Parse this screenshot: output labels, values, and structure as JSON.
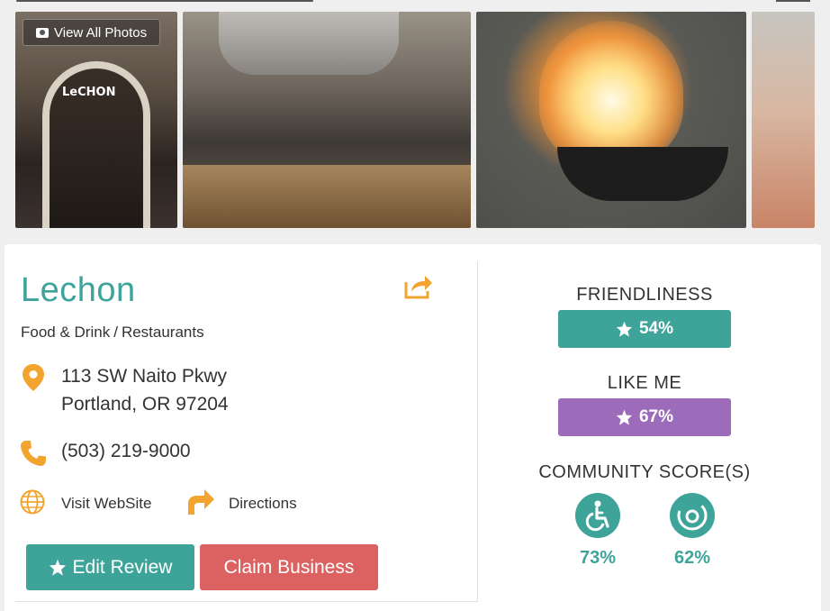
{
  "gallery": {
    "view_all_label": "View All Photos",
    "storefront_sign": "LeCHON"
  },
  "business": {
    "name": "Lechon",
    "category": "Food & Drink",
    "subcategory": "Restaurants",
    "address_line1": "113 SW Naito Pkwy",
    "address_line2": "Portland, OR 97204",
    "phone": "(503) 219-9000",
    "website_label": "Visit WebSite",
    "directions_label": "Directions"
  },
  "actions": {
    "edit_review": "Edit Review",
    "claim_business": "Claim Business"
  },
  "ratings": {
    "friendliness_label": "FRIENDLINESS",
    "friendliness_value": "54%",
    "like_me_label": "LIKE ME",
    "like_me_value": "67%",
    "community_label": "COMMUNITY SCORE(S)",
    "scores": [
      {
        "icon": "wheelchair-icon",
        "value": "73%"
      },
      {
        "icon": "hearing-icon",
        "value": "62%"
      }
    ]
  },
  "colors": {
    "teal": "#3ea49a",
    "purple": "#9c6cbb",
    "red": "#dc6262",
    "orange": "#f2a42f"
  }
}
